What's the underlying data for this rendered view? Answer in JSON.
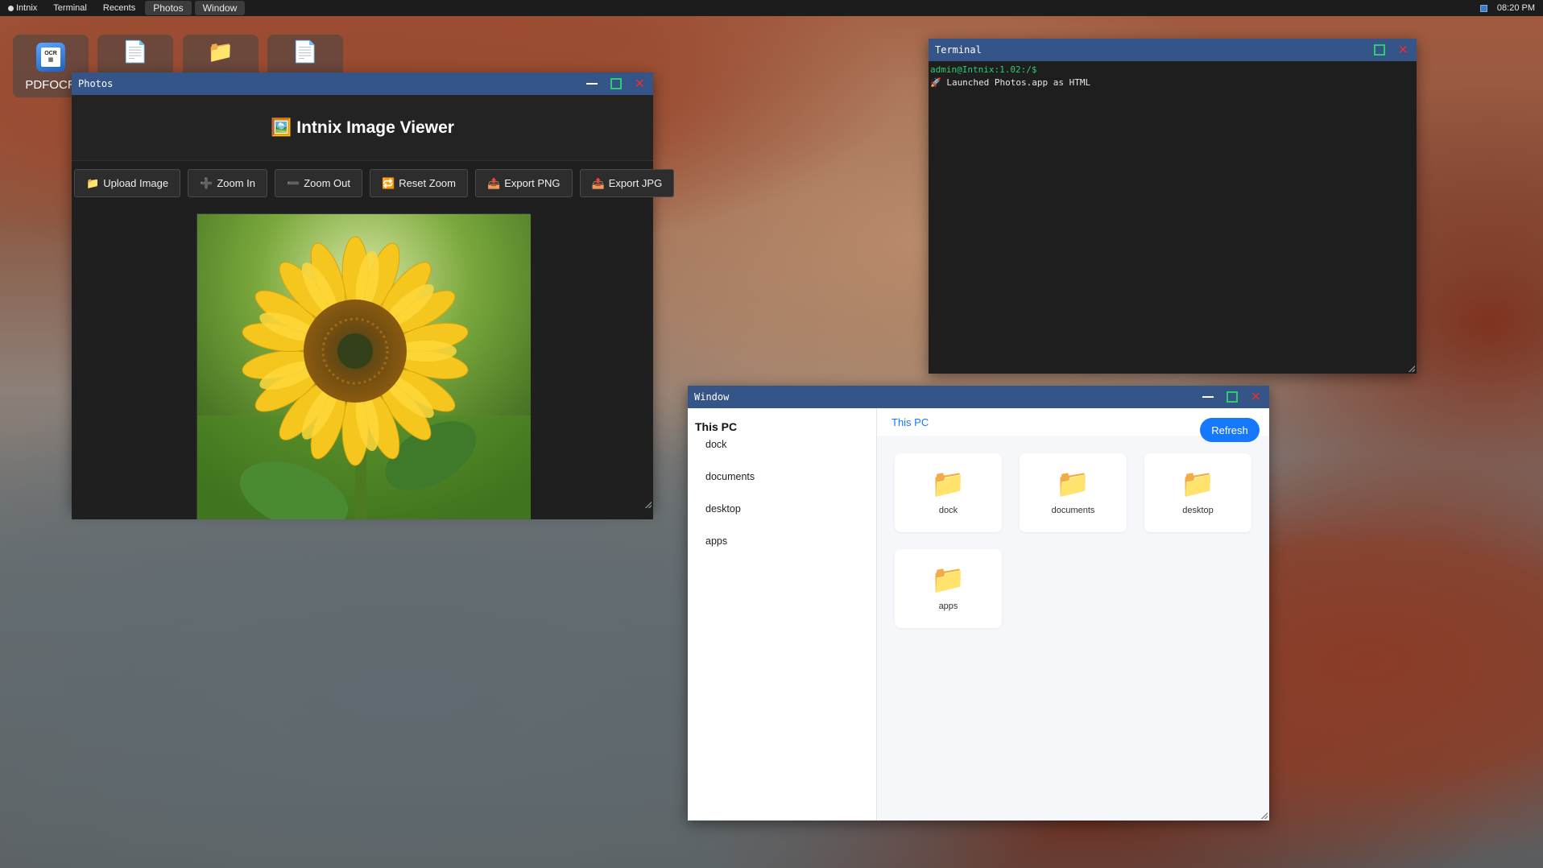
{
  "topbar": {
    "items": [
      "Intnix",
      "Terminal",
      "Recents",
      "Photos",
      "Window"
    ],
    "active_items": [
      "Photos",
      "Window"
    ],
    "clock": "08:20 PM"
  },
  "desktop": {
    "icons": [
      {
        "label": "PDFOCR",
        "icon": "pdfocr-app-icon"
      },
      {
        "label": "",
        "icon": "document-icon"
      },
      {
        "label": "",
        "icon": "folder-icon"
      },
      {
        "label": "",
        "icon": "document-icon"
      }
    ]
  },
  "photos": {
    "title": "Photos",
    "header_icon": "🖼️",
    "header": "Intnix Image Viewer",
    "buttons": [
      {
        "icon": "📁",
        "label": "Upload Image"
      },
      {
        "icon": "➕",
        "label": "Zoom In"
      },
      {
        "icon": "➖",
        "label": "Zoom Out"
      },
      {
        "icon": "🔁",
        "label": "Reset Zoom"
      },
      {
        "icon": "📤",
        "label": "Export PNG"
      },
      {
        "icon": "📤",
        "label": "Export JPG"
      }
    ]
  },
  "terminal": {
    "title": "Terminal",
    "prompt": "admin@Intnix:1.02:/$",
    "output": "🚀 Launched Photos.app as HTML"
  },
  "explorer": {
    "title": "Window",
    "sidebar_title": "This PC",
    "sidebar_items": [
      "dock",
      "documents",
      "desktop",
      "apps"
    ],
    "path": "This PC",
    "refresh_label": "Refresh",
    "folders": [
      "dock",
      "documents",
      "desktop",
      "apps"
    ],
    "folder_icon": "📁"
  },
  "colors": {
    "titlebar": "#355487",
    "accent": "#1677ff",
    "maximize": "#2ecc71",
    "close": "#e03131",
    "terminal_prompt": "#2ecc71"
  }
}
